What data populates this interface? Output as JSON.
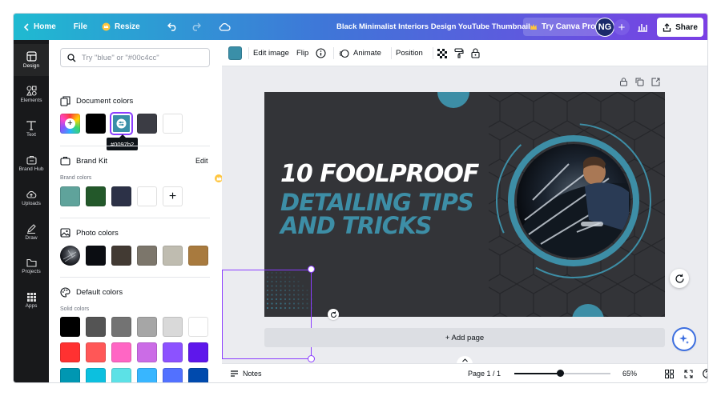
{
  "topbar": {
    "home_label": "Home",
    "file_label": "File",
    "resize_label": "Resize",
    "doc_title": "Black Minimalist Interiors Design YouTube Thumbnail",
    "try_pro_label": "Try Canva Pro",
    "avatar_initials": "NG",
    "add_label": "+",
    "share_label": "Share"
  },
  "rail": {
    "items": [
      {
        "label": "Design",
        "icon": "design-icon"
      },
      {
        "label": "Elements",
        "icon": "elements-icon"
      },
      {
        "label": "Text",
        "icon": "text-icon"
      },
      {
        "label": "Brand Hub",
        "icon": "brand-hub-icon"
      },
      {
        "label": "Uploads",
        "icon": "uploads-icon"
      },
      {
        "label": "Draw",
        "icon": "draw-icon"
      },
      {
        "label": "Projects",
        "icon": "projects-icon"
      },
      {
        "label": "Apps",
        "icon": "apps-icon"
      }
    ]
  },
  "panel": {
    "search_placeholder": "Try \"blue\" or \"#00c4cc\"",
    "document_colors_title": "Document colors",
    "document_colors": [
      "#000000",
      "#3a8fa8",
      "#3b3c44",
      "#ffffff"
    ],
    "selected_color_tooltip": "#0097b2",
    "brand_kit_title": "Brand Kit",
    "brand_kit_edit": "Edit",
    "brand_colors_label": "Brand colors",
    "brand_colors": [
      "#5fa39b",
      "#23582a",
      "#2c3147",
      "#ffffff"
    ],
    "photo_colors_title": "Photo colors",
    "photo_colors": [
      "#0b0d12",
      "#423a33",
      "#7c766b",
      "#bfbcb0",
      "#a87a3e"
    ],
    "default_colors_title": "Default colors",
    "solid_colors_label": "Solid colors",
    "solid_colors_rows": [
      [
        "#000000",
        "#545454",
        "#737373",
        "#a6a6a6",
        "#d9d9d9",
        "#ffffff"
      ],
      [
        "#ff3131",
        "#ff5757",
        "#ff66c4",
        "#cb6ce6",
        "#8c52ff",
        "#5e17eb"
      ],
      [
        "#0097b2",
        "#0cc0df",
        "#5ce1e6",
        "#38b6ff",
        "#5271ff",
        "#004aad"
      ]
    ]
  },
  "toolbar": {
    "swatch_color": "#3a8fa8",
    "edit_image_label": "Edit image",
    "flip_label": "Flip",
    "animate_label": "Animate",
    "position_label": "Position"
  },
  "design": {
    "headline_line1": "10 FOOLPROOF",
    "headline_line2": "DETAILING TIPS",
    "headline_line3": "AND TRICKS",
    "accent_color": "#3d8ea6",
    "background_color": "#333438"
  },
  "canvas": {
    "add_page_label": "+ Add page"
  },
  "bottombar": {
    "notes_label": "Notes",
    "page_indicator": "Page 1 / 1",
    "zoom_value": "65%",
    "zoom_fraction": 0.48
  }
}
